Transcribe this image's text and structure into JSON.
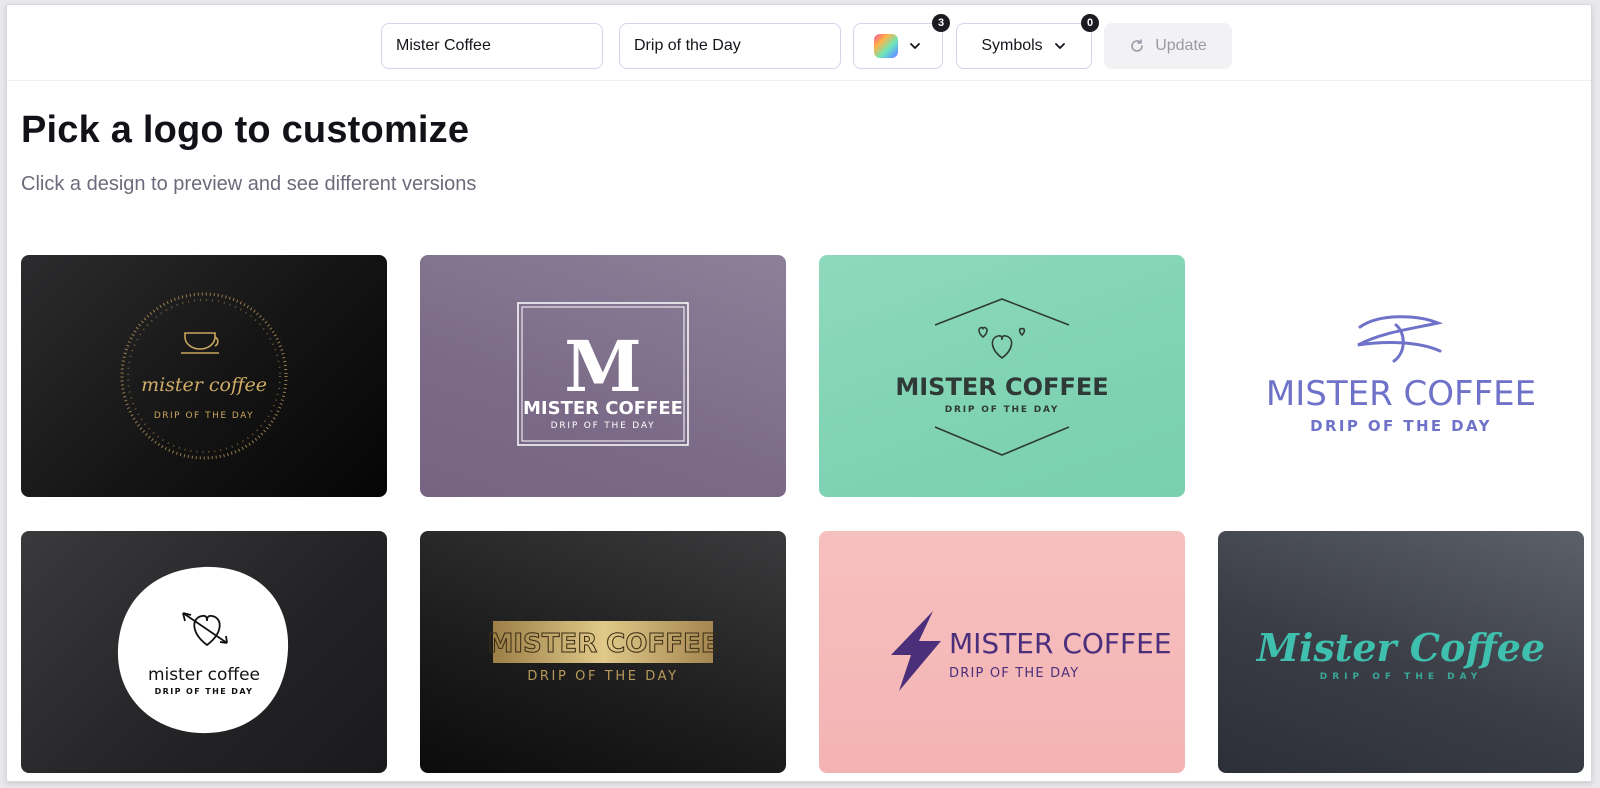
{
  "toolbar": {
    "company_name_value": "Mister Coffee",
    "slogan_value": "Drip of the Day",
    "colors_badge": "3",
    "symbols_label": "Symbols",
    "symbols_badge": "0",
    "update_label": "Update"
  },
  "header": {
    "title": "Pick a logo to customize",
    "subtitle": "Click a design to preview and see different versions"
  },
  "logos": [
    {
      "name": "mister coffee",
      "slogan": "DRIP OF THE DAY",
      "style": "gold script in dotted circle with cup",
      "accent": "#c9a45c"
    },
    {
      "name": "MISTER COFFEE",
      "slogan": "DRIP OF THE DAY",
      "monogram": "M",
      "style": "white framed collegiate",
      "accent": "#ffffff"
    },
    {
      "name": "MISTER COFFEE",
      "slogan": "DRIP OF THE DAY",
      "style": "dark condensed with hearts badge",
      "accent": "#2f3a36"
    },
    {
      "name": "MISTER COFFEE",
      "slogan": "DRIP OF THE DAY",
      "style": "periwinkle with flourish",
      "accent": "#6f72c9"
    },
    {
      "name": "mister coffee",
      "slogan": "DRIP OF THE DAY",
      "style": "black on white blob with heart and arrow",
      "accent": "#111111"
    },
    {
      "name": "MISTER COFFEE",
      "slogan": "DRIP OF THE DAY",
      "style": "gold plate outlined",
      "accent": "#b89a5a"
    },
    {
      "name": "MISTER COFFEE",
      "slogan": "DRIP OF THE DAY",
      "style": "purple lightning",
      "accent": "#4b2f7a"
    },
    {
      "name": "Mister Coffee",
      "slogan": "DRIP OF THE DAY",
      "style": "teal script",
      "accent": "#3fbfae"
    }
  ],
  "icons": {
    "colors": "palette-swatch-icon",
    "dropdown": "chevron-down-icon",
    "update": "refresh-icon"
  }
}
